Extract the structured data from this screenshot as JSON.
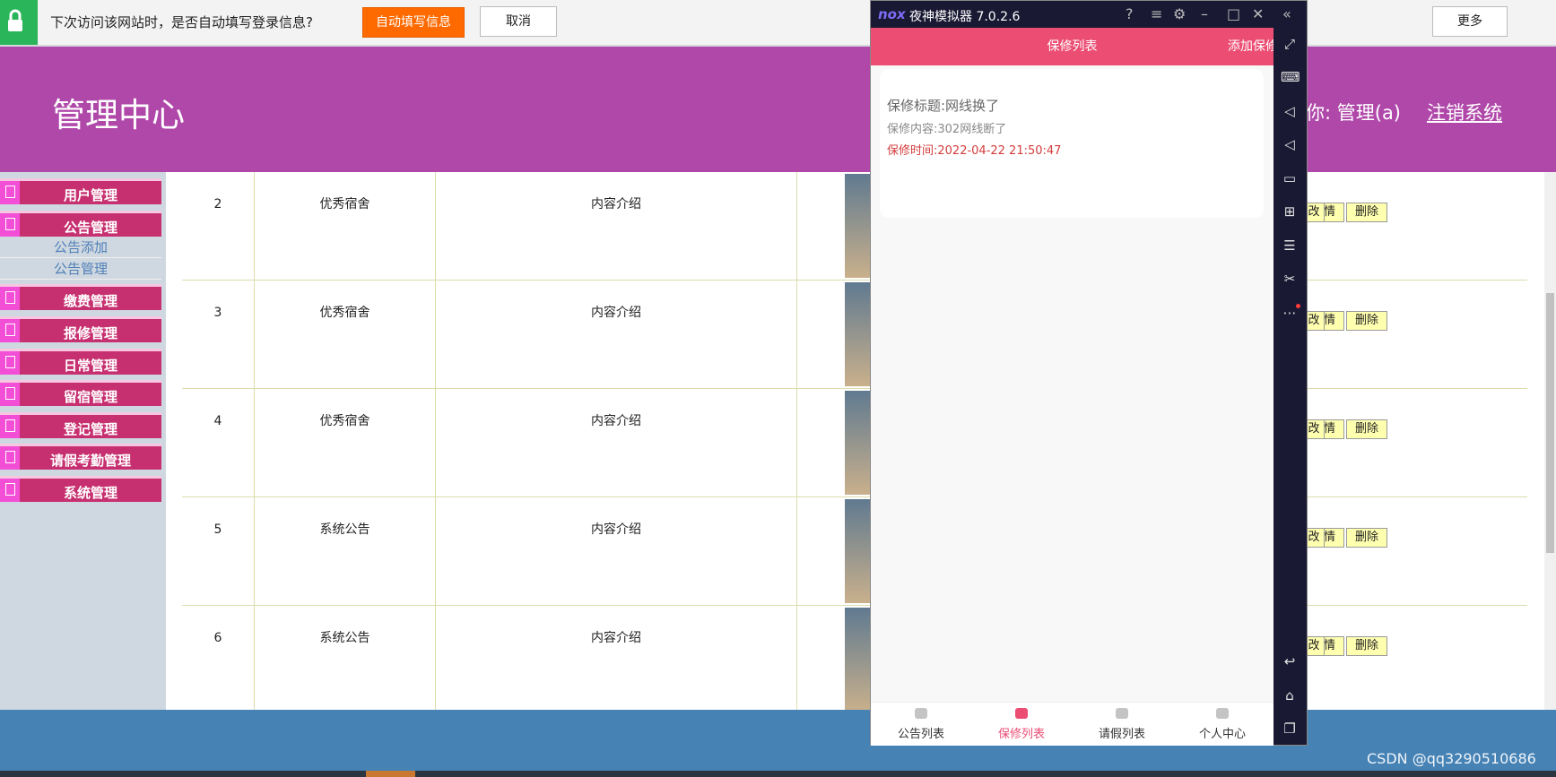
{
  "autofill_bar": {
    "message": "下次访问该网站时，是否自动填写登录信息?",
    "fill_button": "自动填写信息",
    "cancel_button": "取消",
    "more_button": "更多",
    "accent": "#ff6a00",
    "lock_icon": "lock-icon"
  },
  "header": {
    "title": "管理中心",
    "welcome": "你:  管理(a)",
    "logout": "注销系统",
    "background": "#b048aa"
  },
  "sidebar": {
    "items": [
      {
        "label": "用户管理"
      },
      {
        "label": "公告管理"
      },
      {
        "label": "缴费管理"
      },
      {
        "label": "报修管理"
      },
      {
        "label": "日常管理"
      },
      {
        "label": "留宿管理"
      },
      {
        "label": "登记管理"
      },
      {
        "label": "请假考勤管理"
      },
      {
        "label": "系统管理"
      }
    ],
    "submenu": [
      {
        "label": "公告添加"
      },
      {
        "label": "公告管理"
      }
    ]
  },
  "table": {
    "rows": [
      {
        "id": "2",
        "title": "优秀宿舍",
        "content": "内容介绍"
      },
      {
        "id": "3",
        "title": "优秀宿舍",
        "content": "内容介绍"
      },
      {
        "id": "4",
        "title": "优秀宿舍",
        "content": "内容介绍"
      },
      {
        "id": "5",
        "title": "系统公告",
        "content": "内容介绍"
      },
      {
        "id": "6",
        "title": "系统公告",
        "content": "内容介绍"
      }
    ],
    "actions": {
      "edit_partial": "改",
      "detail": "详情",
      "delete": "删除"
    }
  },
  "footer": {
    "watermark": "CSDN @qq3290510686",
    "background": "#4682b4"
  },
  "emulator": {
    "logo": "nox",
    "name": "夜神模拟器 7.0.2.6",
    "app": {
      "title": "保修列表",
      "add_button": "添加保修",
      "accent": "#ec4d73",
      "card": {
        "title": "保修标题:网线换了",
        "content": "保修内容:302网线断了",
        "time": "保修时间:2022-04-22 21:50:47"
      },
      "tabs": [
        {
          "label": "公告列表",
          "icon": "home-icon",
          "active": false
        },
        {
          "label": "保修列表",
          "icon": "repair-icon",
          "active": true
        },
        {
          "label": "请假列表",
          "icon": "grad-cap-icon",
          "active": false
        },
        {
          "label": "个人中心",
          "icon": "user-icon",
          "active": false
        }
      ]
    }
  }
}
